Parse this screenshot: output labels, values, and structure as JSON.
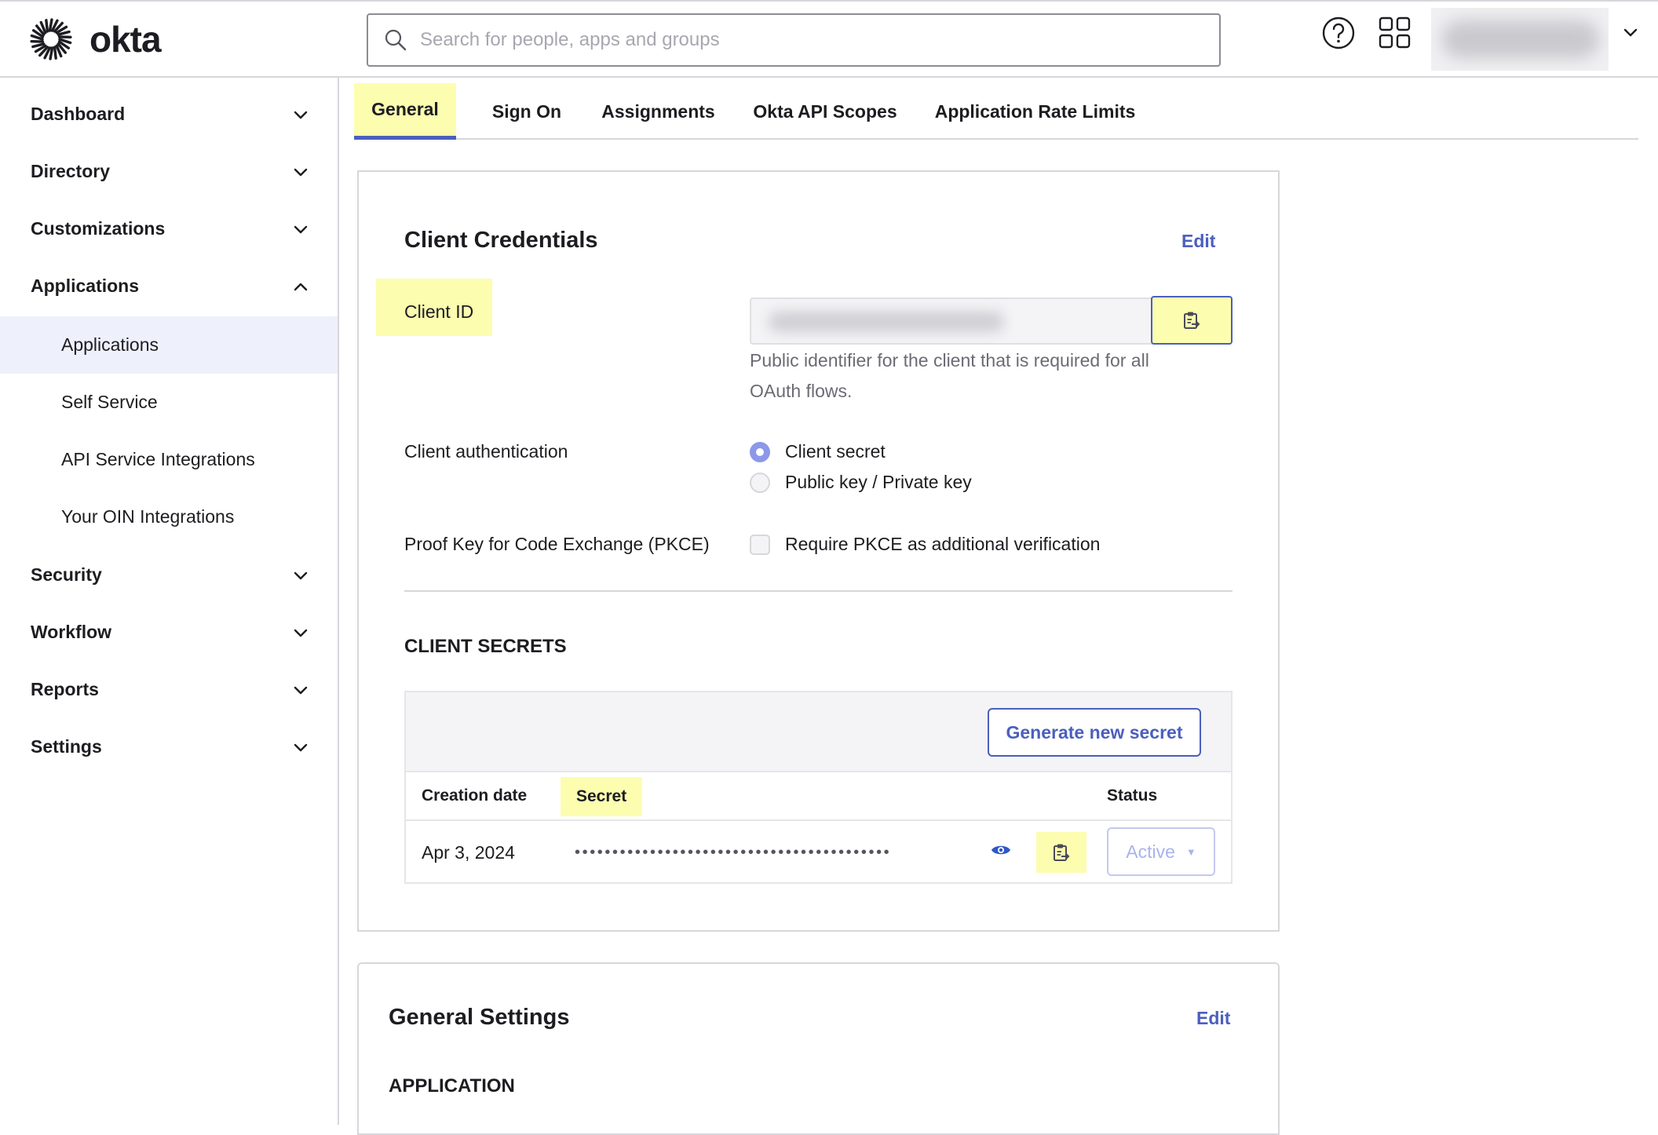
{
  "header": {
    "logo_text": "okta",
    "search_placeholder": "Search for people, apps and groups"
  },
  "sidebar": {
    "items": [
      {
        "label": "Dashboard"
      },
      {
        "label": "Directory"
      },
      {
        "label": "Customizations"
      },
      {
        "label": "Applications"
      },
      {
        "label": "Security"
      },
      {
        "label": "Workflow"
      },
      {
        "label": "Reports"
      },
      {
        "label": "Settings"
      }
    ],
    "applications_sub": [
      {
        "label": "Applications"
      },
      {
        "label": "Self Service"
      },
      {
        "label": "API Service Integrations"
      },
      {
        "label": "Your OIN Integrations"
      }
    ]
  },
  "tabs": [
    {
      "label": "General"
    },
    {
      "label": "Sign On"
    },
    {
      "label": "Assignments"
    },
    {
      "label": "Okta API Scopes"
    },
    {
      "label": "Application Rate Limits"
    }
  ],
  "client_credentials": {
    "title": "Client Credentials",
    "edit_label": "Edit",
    "client_id_label": "Client ID",
    "client_id_help": "Public identifier for the client that is required for all OAuth flows.",
    "client_auth_label": "Client authentication",
    "auth_options": [
      {
        "label": "Client secret",
        "selected": true
      },
      {
        "label": "Public key / Private key",
        "selected": false
      }
    ],
    "pkce_label": "Proof Key for Code Exchange (PKCE)",
    "pkce_option": "Require PKCE as additional verification"
  },
  "client_secrets": {
    "title": "CLIENT SECRETS",
    "generate_label": "Generate new secret",
    "columns": [
      "Creation date",
      "Secret",
      "Status"
    ],
    "rows": [
      {
        "date": "Apr 3, 2024",
        "secret": "••••••••••••••••••••••••••••••••••••••••••",
        "status": "Active"
      }
    ]
  },
  "general_settings": {
    "title": "General Settings",
    "edit_label": "Edit",
    "section": "APPLICATION"
  },
  "colors": {
    "accent": "#4b5fbd",
    "highlight": "#fdfdb0",
    "active_nav_bg": "#eef0fb"
  },
  "icons": [
    "okta-sunburst-icon",
    "search-icon",
    "help-icon",
    "app-grid-icon",
    "chevron-down-icon",
    "chevron-up-icon",
    "clipboard-copy-icon",
    "eye-icon",
    "caret-down-icon"
  ]
}
